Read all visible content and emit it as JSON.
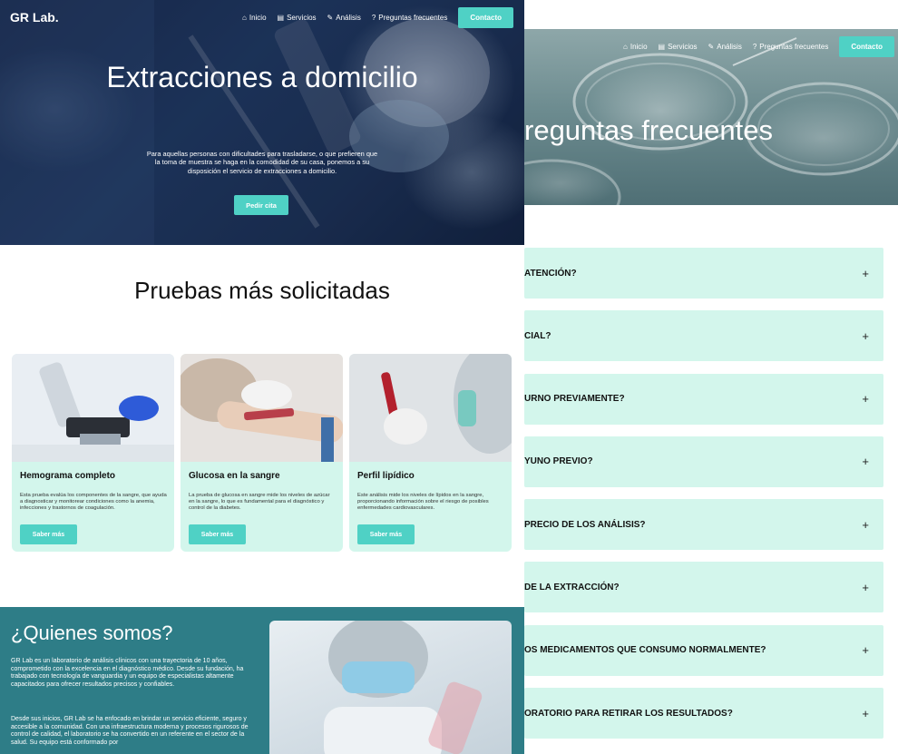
{
  "brand": {
    "logo": "GR Lab.",
    "accent": "#4fd1c5",
    "card_bg": "#d3f6ec",
    "about_bg": "#2e7d87"
  },
  "nav": {
    "items": [
      {
        "label": "Inicio",
        "icon": "home-icon"
      },
      {
        "label": "Servicios",
        "icon": "clipboard-icon"
      },
      {
        "label": "Análisis",
        "icon": "syringe-icon"
      },
      {
        "label": "Preguntas frecuentes",
        "icon": "question-circle-icon"
      }
    ],
    "contact": "Contacto"
  },
  "hero": {
    "title": "Extracciones a domicilio",
    "text": "Para aquellas personas con dificultades para trasladarse, o que prefieren que la toma de muestra se haga en la comodidad de su casa, ponemos a su disposición el servicio de extracciones a domicilio.",
    "button": "Pedir cita"
  },
  "tests": {
    "title": "Pruebas más solicitadas",
    "cards": [
      {
        "name": "Hemograma completo",
        "desc": "Esta prueba evalúa los componentes de la sangre, que ayuda a diagnosticar y monitorear condiciones como la anemia, infecciones y trastornos de coagulación.",
        "button": "Saber más"
      },
      {
        "name": "Glucosa en la sangre",
        "desc": "La prueba de glucosa en sangre mide los niveles de azúcar en la sangre, lo que es fundamental para el diagnóstico y control de la diabetes.",
        "button": "Saber más"
      },
      {
        "name": "Perfil lipídico",
        "desc": "Este análisis mide los niveles de lípidos en la sangre, proporcionando información sobre el riesgo de posibles enfermedades cardiovasculares.",
        "button": "Saber más"
      }
    ]
  },
  "about": {
    "title": "¿Quienes somos?",
    "p1": "GR Lab es un laboratorio de análisis clínicos con una trayectoria de 10 años, comprometido con la excelencia en el diagnóstico médico. Desde su fundación, ha trabajado con tecnología de vanguardia y un equipo de especialistas altamente capacitados para ofrecer resultados precisos y confiables.",
    "p2": "Desde sus inicios, GR Lab se ha enfocado en brindar un servicio eficiente, seguro y accesible a la comunidad. Con una infraestructura moderna y procesos rigurosos de control de calidad, el laboratorio se ha convertido en un referente en el sector de la salud. Su equipo está conformado por"
  },
  "faq": {
    "title": "reguntas frecuentes",
    "items": [
      {
        "q": "ATENCIÓN?",
        "toggle": "+"
      },
      {
        "q": "CIAL?",
        "toggle": "+"
      },
      {
        "q": "URNO PREVIAMENTE?",
        "toggle": "+"
      },
      {
        "q": "YUNO PREVIO?",
        "toggle": "+"
      },
      {
        "q": "PRECIO DE LOS ANÁLISIS?",
        "toggle": "+"
      },
      {
        "q": "DE LA EXTRACCIÓN?",
        "toggle": "+"
      },
      {
        "q": "OS MEDICAMENTOS QUE CONSUMO NORMALMENTE?",
        "toggle": "+"
      },
      {
        "q": "ORATORIO PARA RETIRAR LOS RESULTADOS?",
        "toggle": "+"
      }
    ]
  }
}
